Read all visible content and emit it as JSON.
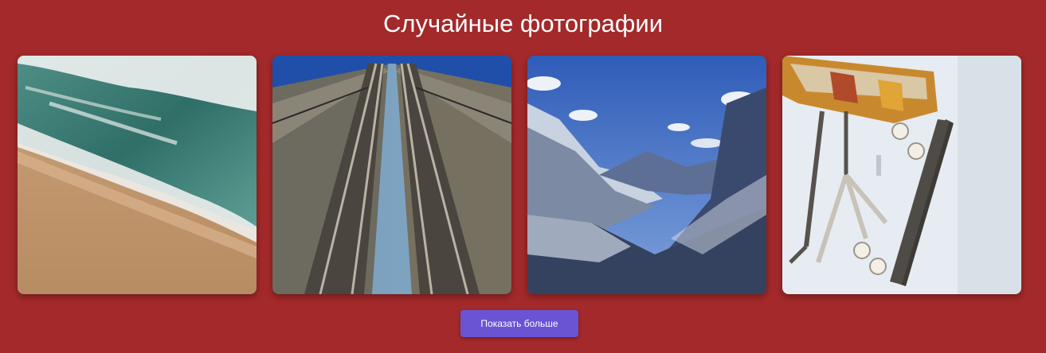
{
  "page": {
    "title": "Случайные фотографии"
  },
  "gallery": {
    "photos": [
      {
        "subject": "beach-waves"
      },
      {
        "subject": "railway-tracks"
      },
      {
        "subject": "snowy-mountains"
      },
      {
        "subject": "skateboard-chair"
      }
    ]
  },
  "actions": {
    "show_more_label": "Показать больше"
  },
  "colors": {
    "background": "#a3292a",
    "button": "#6a54d4",
    "title_text": "#ffffff"
  }
}
